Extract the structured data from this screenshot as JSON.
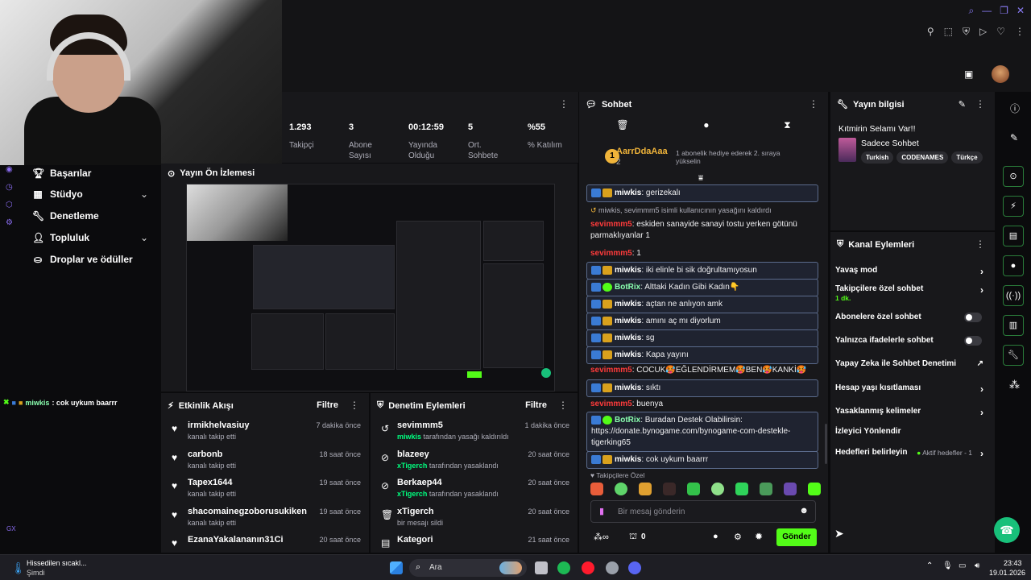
{
  "topbar": {
    "profile_avatar": "avatar"
  },
  "sidebar": {
    "items": [
      {
        "label": "Başarılar",
        "icon": "trophy-icon"
      },
      {
        "label": "Stüdyo",
        "icon": "studio-icon"
      },
      {
        "label": "Denetleme",
        "icon": "wrench-icon"
      },
      {
        "label": "Topluluk",
        "icon": "community-icon"
      },
      {
        "label": "Droplar ve ödüller",
        "icon": "gift-icon"
      }
    ],
    "gx_label": "GX"
  },
  "stats": [
    {
      "value": "1.293",
      "label": "Takipçi"
    },
    {
      "value": "3",
      "label": "Abone Sayısı"
    },
    {
      "value": "00:12:59",
      "label": "Yayında Olduğu"
    },
    {
      "value": "5",
      "label": "Ort. Sohbete"
    },
    {
      "value": "%55",
      "label": "% Katılım"
    }
  ],
  "preview": {
    "title": "Yayın Ön İzlemesi"
  },
  "ticker": {
    "user": "miwkis",
    "text": ": cok uykum baarrr"
  },
  "activity": {
    "title": "Etkinlik Akışı",
    "filter": "Filtre",
    "rows": [
      {
        "name": "irmikhelvasiuy",
        "sub": "kanalı takip etti",
        "time": "7 dakika önce"
      },
      {
        "name": "carbonb",
        "sub": "kanalı takip etti",
        "time": "18 saat önce"
      },
      {
        "name": "Tapex1644",
        "sub": "kanalı takip etti",
        "time": "19 saat önce"
      },
      {
        "name": "shacomainegzoborusukiken",
        "sub": "kanalı takip etti",
        "time": "19 saat önce"
      },
      {
        "name": "EzanaYakalananın31Ci",
        "sub": "",
        "time": "20 saat önce"
      }
    ]
  },
  "moderation": {
    "title": "Denetim Eylemleri",
    "filter": "Filtre",
    "rows": [
      {
        "name": "sevimmm5",
        "actor": "miwkis",
        "sub": "tarafından yasağı kaldırıldı",
        "time": "1 dakika önce"
      },
      {
        "name": "blazeey",
        "actor": "xTigerch",
        "sub": "tarafından yasaklandı",
        "time": "20 saat önce"
      },
      {
        "name": "Berkaep44",
        "actor": "xTigerch",
        "sub": "tarafından yasaklandı",
        "time": "20 saat önce"
      },
      {
        "name": "xTigerch",
        "actor": "",
        "sub": "bir mesajı sildi",
        "time": "20 saat önce"
      },
      {
        "name": "Kategori",
        "actor": "",
        "sub": "",
        "time": "21 saat önce"
      }
    ]
  },
  "chat": {
    "title": "Sohbet",
    "pinned": {
      "user": "AarrDdaAaa",
      "count": "2",
      "text": "1 abonelik hediye ederek 2. sıraya yükselin"
    },
    "messages": [
      {
        "user": "miwkis",
        "text": ": gerizekalı",
        "style": "hl"
      },
      {
        "user": "",
        "text": "miwkis, sevimmm5 isimli kullanıcının yasağını kaldırdı",
        "style": "sys"
      },
      {
        "user": "sevimmm5",
        "text": ": eskiden sanayide sanayi tostu yerken götünü parmaklıyanlar 1",
        "style": "plain"
      },
      {
        "user": "sevimmm5",
        "text": ": 1",
        "style": "plain"
      },
      {
        "user": "miwkis",
        "text": ": iki elinle bi sik doğrultamıyosun",
        "style": "hl"
      },
      {
        "user": "BotRix",
        "text": ": Alttaki Kadın Gibi Kadın👇",
        "style": "hl"
      },
      {
        "user": "miwkis",
        "text": ": açtan ne anlıyon amk",
        "style": "hl"
      },
      {
        "user": "miwkis",
        "text": ": amını aç mı diyorlum",
        "style": "hl"
      },
      {
        "user": "miwkis",
        "text": ": sg",
        "style": "hl"
      },
      {
        "user": "miwkis",
        "text": ": Kapa yayını",
        "style": "hl"
      },
      {
        "user": "sevimmm5",
        "text": ": COCUK🥵EĞLENDİRMEM🥵BEN🥵KANKİ🥵",
        "style": "plain"
      },
      {
        "user": "miwkis",
        "text": ": sıktı",
        "style": "hl"
      },
      {
        "user": "sevimmm5",
        "text": ": buenya",
        "style": "plain"
      },
      {
        "user": "BotRix",
        "text": ": Buradan Destek Olabilirsin: https://donate.bynogame.com/bynogame-com-destekle-tigerking65",
        "style": "hl"
      },
      {
        "user": "miwkis",
        "text": ": cok uykum baarrr",
        "style": "hl"
      }
    ],
    "followers_label": "Takipçilere Özel",
    "input_placeholder": "Bir mesaj gönderin",
    "points": "0",
    "send_label": "Gönder"
  },
  "stream_info": {
    "header": "Yayın bilgisi",
    "title": "Kıtmirin Selamı Var!!",
    "category": "Sadece Sohbet",
    "tags": [
      "Turkish",
      "CODENAMES",
      "Türkçe"
    ]
  },
  "channel_actions": {
    "header": "Kanal Eylemleri",
    "items": [
      {
        "label": "Yavaş mod",
        "kind": "chevron",
        "sub": ""
      },
      {
        "label": "Takipçilere özel sohbet",
        "kind": "chevron",
        "sub": "1 dk."
      },
      {
        "label": "Abonelere özel sohbet",
        "kind": "toggle",
        "sub": ""
      },
      {
        "label": "Yalnızca ifadelerle sohbet",
        "kind": "toggle",
        "sub": ""
      },
      {
        "label": "Yapay Zeka ile Sohbet Denetimi",
        "kind": "external",
        "sub": ""
      },
      {
        "label": "Hesap yaşı kısıtlaması",
        "kind": "chevron",
        "sub": ""
      },
      {
        "label": "Yasaklanmış kelimeler",
        "kind": "chevron",
        "sub": ""
      },
      {
        "label": "İzleyici Yönlendir",
        "kind": "none",
        "sub": ""
      },
      {
        "label": "Hedefleri belirleyin",
        "kind": "chevron",
        "sub": "Aktif hedefler - 1"
      }
    ]
  },
  "taskbar": {
    "weather_title": "Hissedilen sıcakl...",
    "weather_sub": "Şimdi",
    "search": "Ara",
    "time": "23:43",
    "date": "19.01.2026"
  },
  "colors": {
    "accent": "#53fc18",
    "background": "#0b0b0d",
    "panel": "#18181b"
  }
}
